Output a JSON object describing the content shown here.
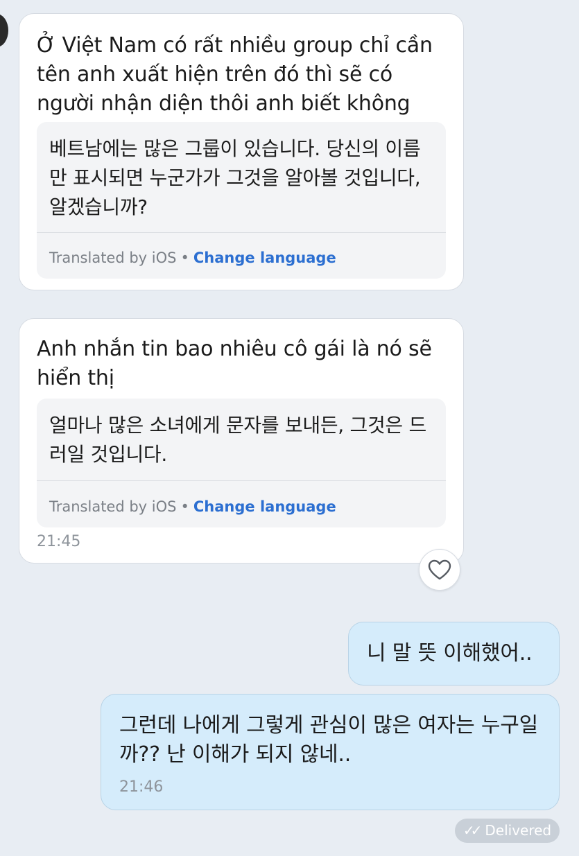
{
  "messages": {
    "m1": {
      "text": "Ở Việt Nam có rất nhiều group chỉ cần tên anh xuất hiện trên đó thì sẽ có người nhận diện thôi anh biết không",
      "translation": "베트남에는 많은 그룹이 있습니다. 당신의 이름만 표시되면 누군가가 그것을 알아볼 것입니다, 알겠습니까?",
      "translated_by": "Translated by iOS",
      "separator": "•",
      "change_language": "Change language"
    },
    "m2": {
      "text": "Anh nhắn tin bao nhiêu cô gái là nó sẽ hiển thị",
      "translation": "얼마나 많은 소녀에게 문자를 보내든, 그것은 드러일 것입니다.",
      "translated_by": "Translated by iOS",
      "separator": "•",
      "change_language": "Change language",
      "time": "21:45"
    },
    "m3": {
      "text": "니 말 뜻 이해했어.."
    },
    "m4": {
      "text": "그런데 나에게 그렇게 관심이 많은 여자는 누구일까?? 난 이해가 되지 않네..",
      "time": "21:46"
    }
  },
  "status": {
    "check_glyph": "✓✓",
    "delivered_label": "Delivered"
  },
  "icons": {
    "reaction": "heart-icon",
    "delivered": "double-check-icon"
  },
  "colors": {
    "background": "#e8edf3",
    "incoming_bubble": "#ffffff",
    "outgoing_bubble": "#d5ecfb",
    "link": "#2c6fd1",
    "delivered_badge": "#c9d0d8"
  }
}
